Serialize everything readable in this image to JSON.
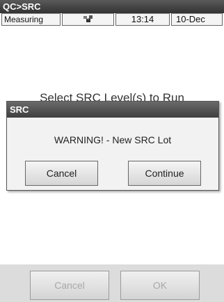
{
  "window": {
    "title": "QC>SRC"
  },
  "status": {
    "mode": "Measuring",
    "icon": "network-icon",
    "time": "13:14",
    "date": "10-Dec"
  },
  "background": {
    "instruction": "Select SRC Level(s) to Run"
  },
  "dialog": {
    "title": "SRC",
    "message": "WARNING! - New SRC Lot",
    "cancel_label": "Cancel",
    "continue_label": "Continue"
  },
  "bottom": {
    "cancel_label": "Cancel",
    "ok_label": "OK",
    "buttons_disabled": true
  },
  "colors": {
    "titlebar": "#3a3a3a",
    "dialog_bg": "#f2f2f2",
    "bottom_bar": "#dcdcdc",
    "disabled_text": "#a8a8a8"
  }
}
